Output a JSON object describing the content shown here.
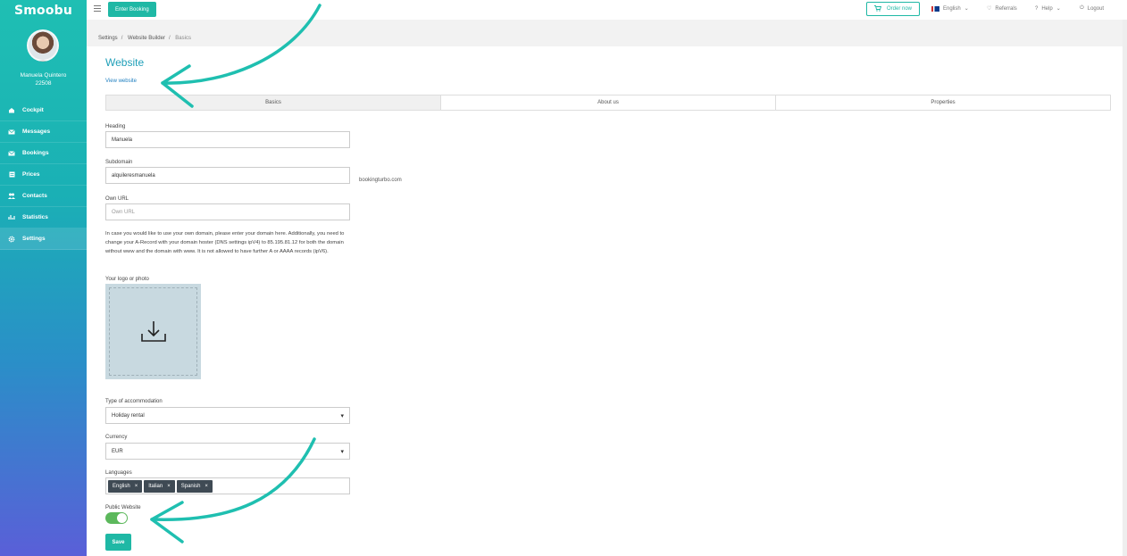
{
  "app": {
    "logo": "Smoobu"
  },
  "user": {
    "name": "Manuela Quintero",
    "id": "22508"
  },
  "sidebar": {
    "items": [
      {
        "label": "Cockpit",
        "icon": "home-icon"
      },
      {
        "label": "Messages",
        "icon": "envelope-icon"
      },
      {
        "label": "Bookings",
        "icon": "envelope-icon"
      },
      {
        "label": "Prices",
        "icon": "document-icon"
      },
      {
        "label": "Contacts",
        "icon": "users-icon"
      },
      {
        "label": "Statistics",
        "icon": "bar-chart-icon"
      },
      {
        "label": "Settings",
        "icon": "gear-icon"
      }
    ],
    "active": "Settings"
  },
  "topbar": {
    "enter_booking": "Enter Booking",
    "order_now": "Order now",
    "language": "English",
    "referrals": "Referrals",
    "help": "Help",
    "logout": "Logout"
  },
  "breadcrumb": [
    "Settings",
    "Website Builder",
    "Basics"
  ],
  "page": {
    "title": "Website",
    "view_link": "View website",
    "tabs": [
      "Basics",
      "About us",
      "Properties"
    ],
    "active_tab": "Basics"
  },
  "form": {
    "heading": {
      "label": "Heading",
      "value": "Manuela"
    },
    "subdomain": {
      "label": "Subdomain",
      "value": "alquileresmanuela",
      "suffix": "bookingturbo.com"
    },
    "own_url": {
      "label": "Own URL",
      "placeholder": "Own URL"
    },
    "help_text": "In case you would like to use your own domain, please enter your domain here. Additionally, you need to change your A-Record with your domain hoster (DNS settings ipV4) to 85.195.81.12 for both the domain without www and the domain with www. It is not allowed to have further A or AAAA records (ipV6).",
    "logo": {
      "label": "Your logo or photo"
    },
    "accommodation": {
      "label": "Type of accommodation",
      "value": "Holiday rental"
    },
    "currency": {
      "label": "Currency",
      "value": "EUR"
    },
    "languages": {
      "label": "Languages",
      "values": [
        "English",
        "Italian",
        "Spanish"
      ]
    },
    "public_website": {
      "label": "Public Website",
      "enabled": true
    },
    "save": "Save"
  },
  "colors": {
    "accent": "#1fb8a5",
    "title": "#1f9fb8",
    "toggle_on": "#5cb85c",
    "annotation": "#1fbfb0"
  }
}
